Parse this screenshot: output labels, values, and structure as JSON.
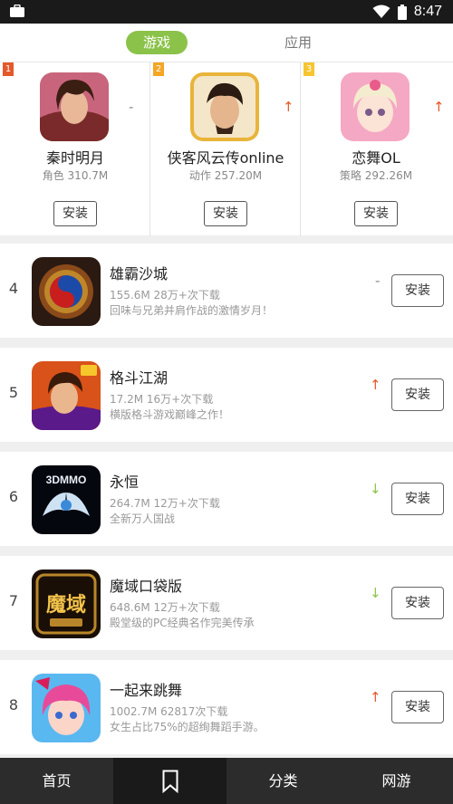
{
  "status_bar": {
    "time": "8:47"
  },
  "tabs": {
    "active_label": "游戏",
    "inactive_label": "应用"
  },
  "top3": [
    {
      "rank": "1",
      "name": "秦时明月",
      "meta": "角色 310.7M",
      "install": "安装",
      "trend": "-"
    },
    {
      "rank": "2",
      "name": "侠客风云传online",
      "meta": "动作 257.20M",
      "install": "安装",
      "trend": "↑"
    },
    {
      "rank": "3",
      "name": "恋舞OL",
      "meta": "策略 292.26M",
      "install": "安装",
      "trend": "↑"
    }
  ],
  "list": [
    {
      "rank": "4",
      "name": "雄霸沙城",
      "meta": "155.6M 28万+次下载",
      "desc": "回味与兄弟并肩作战的激情岁月！",
      "trend": "-",
      "install": "安装"
    },
    {
      "rank": "5",
      "name": "格斗江湖",
      "meta": "17.2M 16万+次下载",
      "desc": "横版格斗游戏巅峰之作！",
      "trend": "↑",
      "install": "安装"
    },
    {
      "rank": "6",
      "name": "永恒",
      "meta": "264.7M 12万+次下载",
      "desc": "全新万人国战",
      "trend": "↓",
      "install": "安装",
      "icon_text": "3DMMO"
    },
    {
      "rank": "7",
      "name": "魔域口袋版",
      "meta": "648.6M 12万+次下载",
      "desc": "殿堂级的PC经典名作完美传承",
      "trend": "↓",
      "install": "安装",
      "icon_text": "魔域"
    },
    {
      "rank": "8",
      "name": "一起来跳舞",
      "meta": "1002.7M 62817次下载",
      "desc": "女生占比75%的超绚舞蹈手游。",
      "trend": "↑",
      "install": "安装"
    }
  ],
  "bottom_nav": {
    "home": "首页",
    "category": "分类",
    "online": "网游"
  },
  "colors": {
    "accent_green": "#8bc34a",
    "trend_up": "#e5582b",
    "trend_down": "#8bc34a",
    "nav_bg": "#2c2c2c"
  }
}
